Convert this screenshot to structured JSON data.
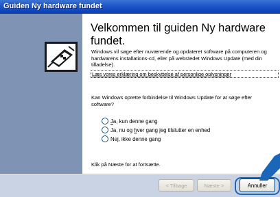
{
  "window": {
    "title": "Guiden Ny hardware fundet"
  },
  "wizard": {
    "heading": "Velkommen til guiden Ny hardware fundet.",
    "intro": "Windows vil søge efter nuværende og opdateret software på computeren og hardwarens installations-cd, eller på webstedet Windows Update (med din tilladelse).",
    "privacy_link": "Læs vores erklæring om beskyttelse af personlige oplysninger",
    "question": "Kan Windows oprette forbindelse til Windows Update for at søge efter software?",
    "options": [
      {
        "prefix": "",
        "key": "J",
        "rest": "a, kun denne gang"
      },
      {
        "prefix": "Ja, nu og ",
        "key": "h",
        "rest": "ver gang jeg tilslutter en enhed"
      },
      {
        "prefix": "Ne",
        "key": "j",
        "rest": ", ikke denne gang"
      }
    ],
    "footer": "Klik på Næste for at fortsætte."
  },
  "buttons": {
    "back": "< Tilbage",
    "next": "Næste >",
    "cancel": "Annuller"
  },
  "colors": {
    "titlebar": "#1f57c8",
    "side_panel": "#7f93b4",
    "highlight": "#1b66b8"
  },
  "icons": [
    "hardware-wizard-icon",
    "pointer-arrow-icon"
  ]
}
